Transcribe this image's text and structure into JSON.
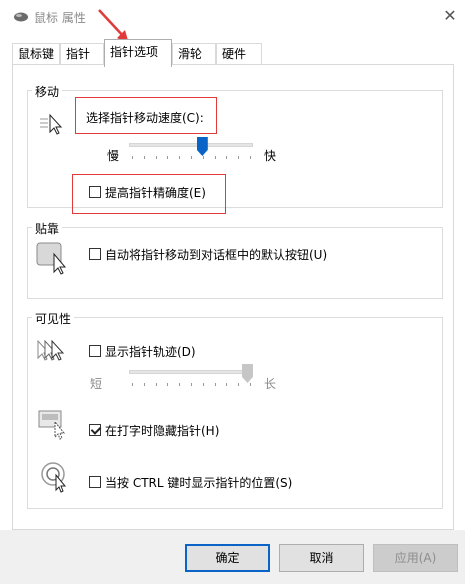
{
  "window": {
    "title": "鼠标 属性",
    "close_glyph": "✕"
  },
  "tabs": [
    {
      "label": "鼠标键"
    },
    {
      "label": "指针"
    },
    {
      "label": "指针选项",
      "active": true
    },
    {
      "label": "滑轮"
    },
    {
      "label": "硬件"
    }
  ],
  "motion": {
    "group_title": "移动",
    "speed_label": "选择指针移动速度(C):",
    "slow_label": "慢",
    "fast_label": "快",
    "speed_level": 0.6,
    "precision_label": "提高指针精确度(E)",
    "precision_checked": false
  },
  "snap": {
    "group_title": "贴靠",
    "snap_label": "自动将指针移动到对话框中的默认按钮(U)",
    "snap_checked": false
  },
  "visibility": {
    "group_title": "可见性",
    "trails_label": "显示指针轨迹(D)",
    "trails_checked": false,
    "short_label": "短",
    "long_label": "长",
    "trail_level": 1.0,
    "hide_label": "在打字时隐藏指针(H)",
    "hide_checked": true,
    "ctrl_label": "当按 CTRL 键时显示指针的位置(S)",
    "ctrl_checked": false
  },
  "buttons": {
    "ok": "确定",
    "cancel": "取消",
    "apply": "应用(A)"
  },
  "colors": {
    "accent": "#0a64c8",
    "annotation_red": "#e03a3a"
  }
}
